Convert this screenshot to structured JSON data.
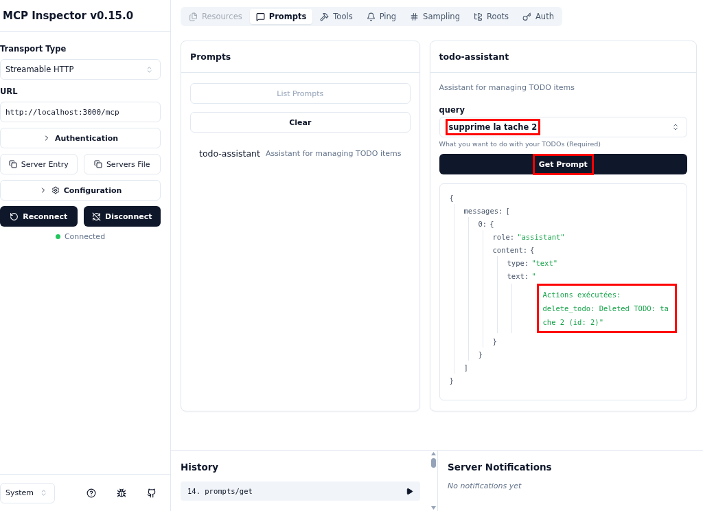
{
  "sidebar": {
    "title": "MCP Inspector v0.15.0",
    "transport": {
      "label": "Transport Type",
      "value": "Streamable HTTP"
    },
    "url": {
      "label": "URL",
      "value": "http://localhost:3000/mcp"
    },
    "authentication": {
      "label": "Authentication",
      "expanded": false
    },
    "copy_buttons": [
      "Server Entry",
      "Servers File"
    ],
    "configuration": {
      "label": "Configuration",
      "expanded": false
    },
    "actions": [
      {
        "kind": "reconnect",
        "label": "Reconnect"
      },
      {
        "kind": "disconnect",
        "label": "Disconnect"
      }
    ],
    "status": {
      "label": "Connected",
      "color": "#22c55e"
    },
    "theme": {
      "value": "System"
    }
  },
  "tabs": [
    {
      "kind": "resources",
      "label": "Resources",
      "selected": false,
      "disabled": true
    },
    {
      "kind": "prompts",
      "label": "Prompts",
      "selected": true,
      "disabled": false
    },
    {
      "kind": "tools",
      "label": "Tools",
      "selected": false,
      "disabled": false
    },
    {
      "kind": "ping",
      "label": "Ping",
      "selected": false,
      "disabled": false
    },
    {
      "kind": "sampling",
      "label": "Sampling",
      "selected": false,
      "disabled": false
    },
    {
      "kind": "roots",
      "label": "Roots",
      "selected": false,
      "disabled": false
    },
    {
      "kind": "auth",
      "label": "Auth",
      "selected": false,
      "disabled": false
    }
  ],
  "prompts_panel": {
    "title": "Prompts",
    "list_button": {
      "label": "List Prompts",
      "disabled": true
    },
    "clear_button": {
      "label": "Clear",
      "disabled": false
    },
    "items": [
      {
        "name": "todo-assistant",
        "description": "Assistant for managing TODO items"
      }
    ]
  },
  "detail_panel": {
    "title": "todo-assistant",
    "description": "Assistant for managing TODO items",
    "argument": {
      "label": "query",
      "value": "supprime la tache 2",
      "hint": "What you want to do with your TODOs (Required)",
      "highlighted": true
    },
    "submit": {
      "label": "Get Prompt",
      "highlighted": true
    },
    "result": {
      "open": "{",
      "close": "}",
      "children": [
        {
          "key": "messages:",
          "open": "[",
          "close": "]",
          "children": [
            {
              "key": "0:",
              "open": "{",
              "close": "}",
              "children": [
                {
                  "key": "role:",
                  "value": "\"assistant\""
                },
                {
                  "key": "content:",
                  "open": "{",
                  "close": "}",
                  "children": [
                    {
                      "key": "type:",
                      "value": "\"text\""
                    },
                    {
                      "key": "text:",
                      "value": "\"",
                      "continuation": "Actions exécutées:\ndelete_todo: Deleted TODO: tache 2 (id: 2)\"",
                      "highlighted": true
                    }
                  ]
                }
              ]
            }
          ]
        }
      ]
    }
  },
  "history": {
    "title": "History",
    "items": [
      {
        "label": "14. prompts/get",
        "expanded": false
      }
    ]
  },
  "notifications": {
    "title": "Server Notifications",
    "empty": "No notifications yet"
  }
}
